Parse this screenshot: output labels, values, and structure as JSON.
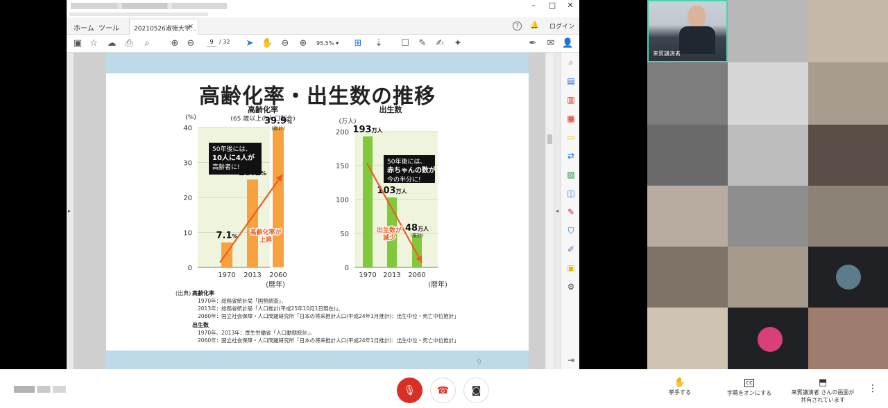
{
  "viewer": {
    "window_controls": [
      "–",
      "□",
      "✕"
    ],
    "tabs": {
      "home": "ホーム",
      "tools": "ツール",
      "document": "20210526淑徳大学…",
      "close": "×"
    },
    "tab_right": {
      "help": "?",
      "bell": "🔔",
      "login": "ログイン"
    },
    "page_current": "9",
    "page_total": "/ 32",
    "zoom": "95.5%"
  },
  "slide": {
    "title": "高齢化率・出生数の推移",
    "page_number": "9",
    "source_label": "(出典)",
    "sources": [
      {
        "heading": "高齢化率",
        "lines": [
          "1970年：総務省統計局「国勢調査」、",
          "2013年：総務省統計局「人口推計(平成25年10月1日現在)」、",
          "2060年：国立社会保障・人口問題研究所「日本の将来推計人口(平成24年1月推計)：出生中位・死亡中位推計」"
        ]
      },
      {
        "heading": "出生数",
        "lines": [
          "1970年、2013年：厚生労働省「人口動態統計」、",
          "2060年：国立社会保障・人口問題研究所「日本の将来推計人口(平成24年1月推計)：出生中位・死亡中位推計」"
        ]
      }
    ]
  },
  "chart_data": [
    {
      "type": "bar",
      "title": "高齢化率",
      "subtitle": "(65 歳以上の人口割合)",
      "ylabel": "(%)",
      "xlabel": "(暦年)",
      "categories": [
        "1970",
        "2013",
        "2060"
      ],
      "values": [
        7.1,
        25.1,
        39.9
      ],
      "value_labels": [
        {
          "num": "7.1",
          "unit": "%",
          "note": ""
        },
        {
          "num": "25.1",
          "unit": "%",
          "note": ""
        },
        {
          "num": "39.9",
          "unit": "%",
          "note": "(推計)"
        }
      ],
      "yticks": [
        0,
        10,
        20,
        30,
        40
      ],
      "ylim": [
        0,
        40
      ],
      "grid": true,
      "bar_color": "#f7a23e",
      "callout": [
        "50年後には、",
        "10人に4人が",
        "高齢者に!"
      ],
      "arrow_label": [
        "高齢化率が",
        "上昇"
      ]
    },
    {
      "type": "bar",
      "title": "出生数",
      "ylabel": "(万人)",
      "xlabel": "(暦年)",
      "categories": [
        "1970",
        "2013",
        "2060"
      ],
      "values": [
        193,
        103,
        48
      ],
      "value_labels": [
        {
          "num": "193",
          "unit": "万人",
          "note": ""
        },
        {
          "num": "103",
          "unit": "万人",
          "note": ""
        },
        {
          "num": "48",
          "unit": "万人",
          "note": "(推計)"
        }
      ],
      "yticks": [
        0,
        50,
        100,
        150,
        200
      ],
      "ylim": [
        0,
        200
      ],
      "grid": true,
      "bar_color": "#7fc93a",
      "callout": [
        "50年後には、",
        "赤ちゃんの数が",
        "今の半分に!"
      ],
      "arrow_label": [
        "出生数が",
        "減少"
      ]
    }
  ],
  "participants": {
    "speaker_name": "来賓講演者"
  },
  "bottom_bar": {
    "raise_hand": "挙手する",
    "captions": "字幕をオンにする",
    "presenting_line1": "来賓講演者 さんの画面が",
    "presenting_line2": "共有されています",
    "more": "⋮"
  },
  "colors": {
    "accent": "#4bd3b0",
    "mic_off": "#d93025",
    "orange_bar": "#f7a23e",
    "green_bar": "#7fc93a",
    "arrow": "#ef5b23"
  }
}
